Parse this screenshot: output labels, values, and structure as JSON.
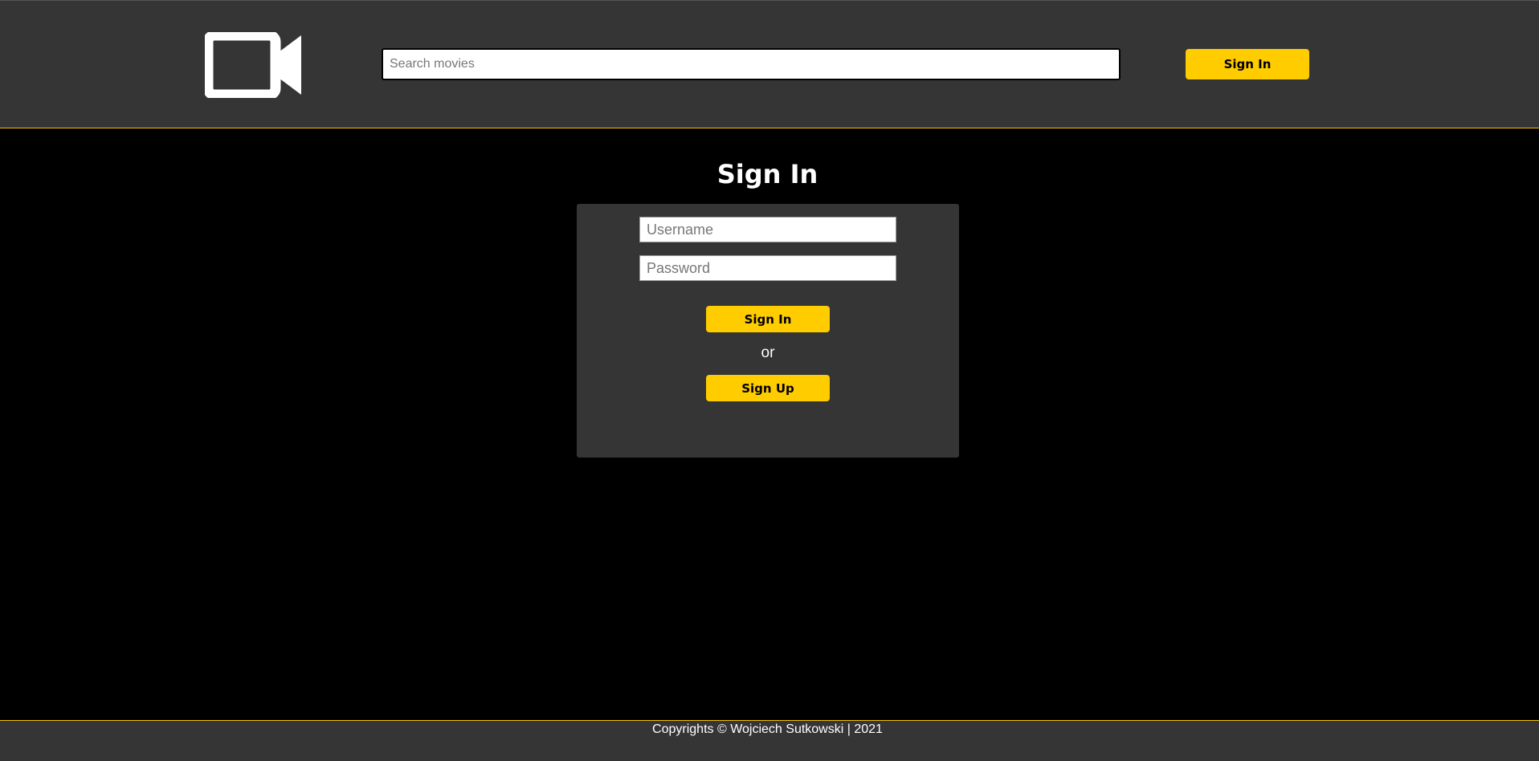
{
  "header": {
    "logo_icon": "video-camera-icon",
    "search_placeholder": "Search movies",
    "signin_label": "Sign In"
  },
  "main": {
    "title": "Sign In",
    "form": {
      "username_placeholder": "Username",
      "password_placeholder": "Password",
      "signin_label": "Sign In",
      "or_text": "or",
      "signup_label": "Sign Up"
    }
  },
  "footer": {
    "text": "Copyrights © Wojciech Sutkowski | 2021"
  },
  "colors": {
    "accent": "#ffcc00",
    "header_bg": "#353535",
    "page_bg": "#000000",
    "border_accent": "#f5c000"
  }
}
